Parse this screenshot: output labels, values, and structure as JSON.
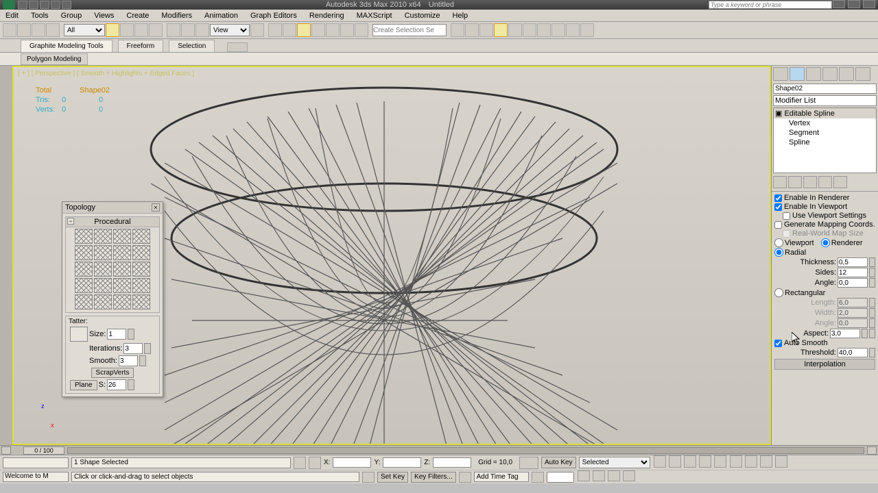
{
  "app": {
    "title_left": "Autodesk 3ds Max  2010 x64",
    "title_right": "Untitled",
    "search_placeholder": "Type a keyword or phrase"
  },
  "menu": [
    "Edit",
    "Tools",
    "Group",
    "Views",
    "Create",
    "Modifiers",
    "Animation",
    "Graph Editors",
    "Rendering",
    "MAXScript",
    "Customize",
    "Help"
  ],
  "toolbar": {
    "filter": "All",
    "refcoord": "View",
    "selset_placeholder": "Create Selection Se"
  },
  "ribbon": {
    "tabs": [
      "Graphite Modeling Tools",
      "Freeform",
      "Selection"
    ],
    "sub": "Polygon Modeling"
  },
  "viewport": {
    "label": "[ + ] [ Perspective ] [ Smooth + Highlights + Edged Faces ]",
    "stats": {
      "h_total": "Total",
      "h_shape": "Shape02",
      "tris_label": "Tris:",
      "tris_total": "0",
      "tris_shape": "0",
      "verts_label": "Verts:",
      "verts_total": "0",
      "verts_shape": "0"
    }
  },
  "topology": {
    "title": "Topology",
    "procedural": "Procedural",
    "tatter": "Tatter:",
    "size_label": "Size:",
    "size": "1",
    "iter_label": "Iterations:",
    "iter": "3",
    "smooth_label": "Smooth:",
    "smooth": "3",
    "scrap": "ScrapVerts",
    "plane": "Plane",
    "s_label": "S:",
    "s": "26"
  },
  "cmd": {
    "name": "Shape02",
    "modlist": "Modifier List",
    "stack_root": "Editable Spline",
    "stack_sub": [
      "Vertex",
      "Segment",
      "Spline"
    ],
    "enable_renderer": "Enable In Renderer",
    "enable_viewport": "Enable In Viewport",
    "use_vp_settings": "Use Viewport Settings",
    "gen_mapping": "Generate Mapping Coords.",
    "real_world": "Real-World Map Size",
    "viewport": "Viewport",
    "renderer": "Renderer",
    "radial": "Radial",
    "thickness_label": "Thickness:",
    "thickness": "0,5",
    "sides_label": "Sides:",
    "sides": "12",
    "angle_label": "Angle:",
    "angle": "0,0",
    "rectangular": "Rectangular",
    "length_label": "Length:",
    "length": "6,0",
    "width_label": "Width:",
    "width": "2,0",
    "angle2_label": "Angle:",
    "angle2": "0,0",
    "aspect_label": "Aspect:",
    "aspect": "3,0",
    "auto_smooth": "Auto Smooth",
    "threshold_label": "Threshold:",
    "threshold": "40,0",
    "interpolation": "Interpolation"
  },
  "timeline": {
    "scrub": "0 / 100"
  },
  "status": {
    "selection": "1 Shape Selected",
    "x": "X:",
    "y": "Y:",
    "z": "Z:",
    "grid": "Grid = 10,0",
    "auto_key": "Auto Key",
    "selected": "Selected",
    "set_key": "Set Key",
    "key_filters": "Key Filters...",
    "welcome": "Welcome to M",
    "prompt": "Click or click-and-drag to select objects",
    "add_tag": "Add Time Tag"
  }
}
